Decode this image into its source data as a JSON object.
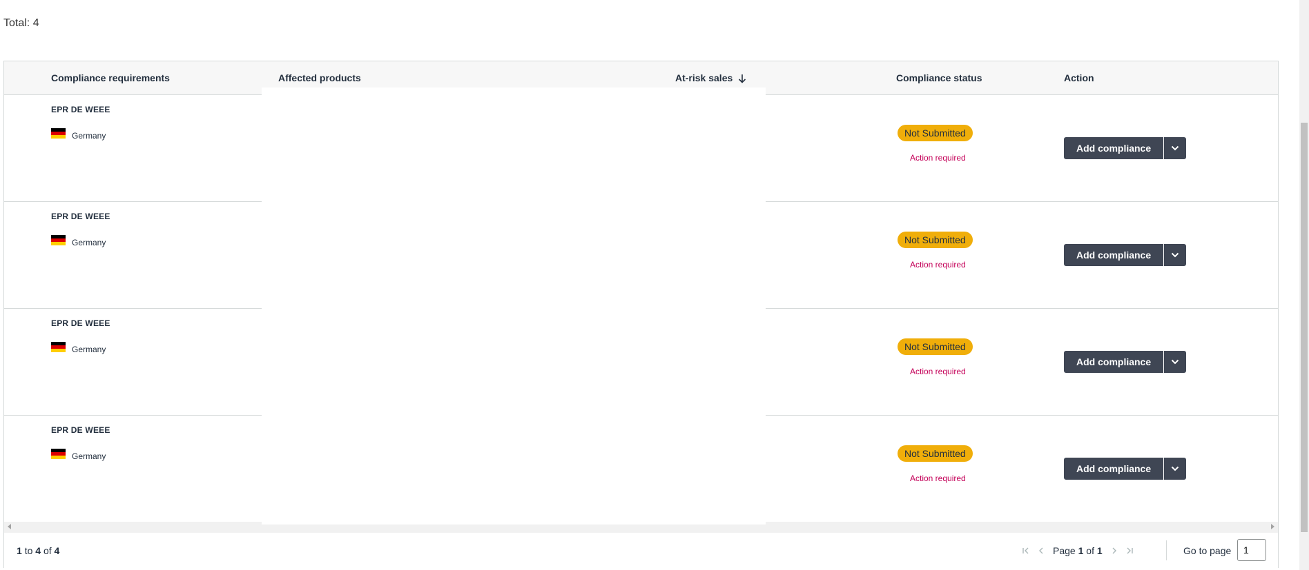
{
  "total_label": "Total: 4",
  "columns": {
    "requirements": "Compliance requirements",
    "products": "Affected products",
    "sales": "At-risk sales",
    "status": "Compliance status",
    "action": "Action"
  },
  "rows": [
    {
      "requirement": "EPR DE WEEE",
      "country": "Germany",
      "status": "Not Submitted",
      "status_note": "Action required",
      "action_label": "Add compliance"
    },
    {
      "requirement": "EPR DE WEEE",
      "country": "Germany",
      "status": "Not Submitted",
      "status_note": "Action required",
      "action_label": "Add compliance"
    },
    {
      "requirement": "EPR DE WEEE",
      "country": "Germany",
      "status": "Not Submitted",
      "status_note": "Action required",
      "action_label": "Add compliance"
    },
    {
      "requirement": "EPR DE WEEE",
      "country": "Germany",
      "status": "Not Submitted",
      "status_note": "Action required",
      "action_label": "Add compliance"
    }
  ],
  "footer": {
    "range_start": "1",
    "range_to": "to",
    "range_end": "4",
    "range_of": "of",
    "range_total": "4",
    "page_word": "Page",
    "page_current": "1",
    "page_of": "of",
    "page_total": "1",
    "goto_label": "Go to page",
    "goto_value": "1"
  },
  "colors": {
    "status_badge": "#f0ae0a",
    "action_required": "#c40058",
    "button": "#3f4654"
  },
  "icons": [
    "sort-down-arrow-icon",
    "chevron-down-icon",
    "first-page-icon",
    "previous-page-icon",
    "next-page-icon",
    "last-page-icon"
  ]
}
